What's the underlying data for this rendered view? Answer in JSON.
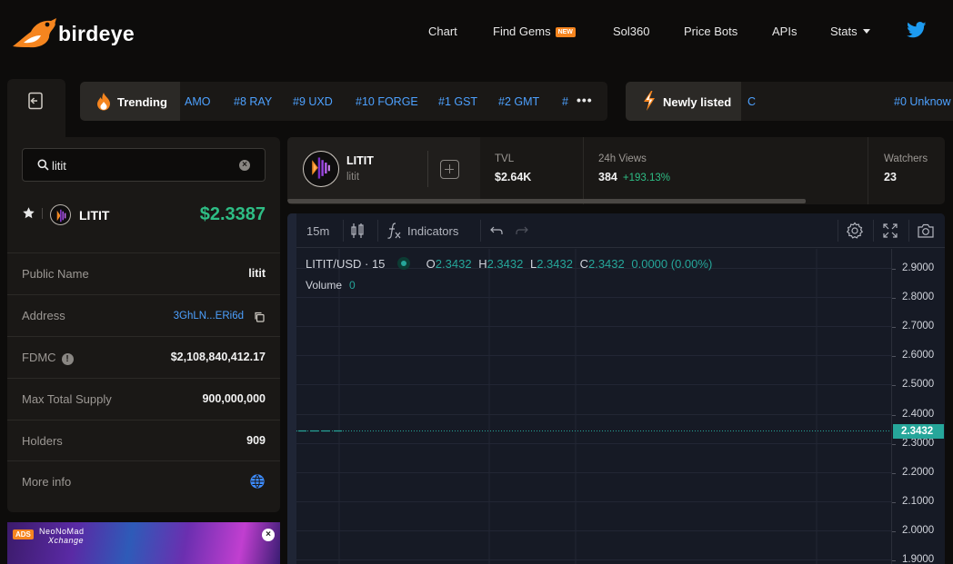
{
  "nav": {
    "brand": "birdeye",
    "items": [
      {
        "label": "Chart"
      },
      {
        "label": "Find Gems",
        "badge": "NEW"
      },
      {
        "label": "Sol360"
      },
      {
        "label": "Price Bots"
      },
      {
        "label": "APIs"
      },
      {
        "label": "Stats"
      }
    ],
    "social_icon": "twitter-icon"
  },
  "search": {
    "value": "litit"
  },
  "token": {
    "name": "LITIT",
    "symbol": "litit",
    "price": "$2.3387"
  },
  "info": {
    "public_name": {
      "label": "Public Name",
      "value": "litit"
    },
    "address": {
      "label": "Address",
      "value": "3GhLN...ERi6d"
    },
    "fdmc": {
      "label": "FDMC",
      "value": "$2,108,840,412.17"
    },
    "max_supply": {
      "label": "Max Total Supply",
      "value": "900,000,000"
    },
    "holders": {
      "label": "Holders",
      "value": "909"
    },
    "more_info": {
      "label": "More info"
    }
  },
  "ad": {
    "badge": "ADS",
    "line1": "NeoNoMad",
    "line2": "Xchange"
  },
  "trending": {
    "label": "Trending",
    "items": [
      "AMO",
      "#8 RAY",
      "#9 UXD",
      "#10 FORGE",
      "#1 GST",
      "#2 GMT",
      "#"
    ],
    "more": "•••"
  },
  "newly": {
    "label": "Newly listed",
    "items": [
      "C",
      "#0 Unknow"
    ]
  },
  "stats": {
    "tvl": {
      "label": "TVL",
      "value": "$2.64K"
    },
    "views": {
      "label": "24h Views",
      "value": "384",
      "change": "+193.13%"
    },
    "watchers": {
      "label": "Watchers",
      "value": "23"
    }
  },
  "chart": {
    "interval": "15m",
    "indicators_label": "Indicators",
    "pair": "LITIT/USD · 15",
    "ohlc": {
      "o_label": "O",
      "o": "2.3432",
      "h_label": "H",
      "h": "2.3432",
      "l_label": "L",
      "l": "2.3432",
      "c_label": "C",
      "c": "2.3432",
      "change": "0.0000 (0.00%)"
    },
    "volume_label": "Volume",
    "volume_value": "0",
    "current_price_tag": "2.3432",
    "colors": {
      "up": "#26a69a",
      "background": "#161a25",
      "grid": "#2a2e39"
    }
  },
  "chart_data": {
    "type": "line",
    "title": "LITIT/USD · 15",
    "xlabel": "",
    "ylabel": "",
    "y_ticks": [
      "2.9000",
      "2.8000",
      "2.7000",
      "2.6000",
      "2.5000",
      "2.4000",
      "2.3000",
      "2.2000",
      "2.1000",
      "2.0000",
      "1.9000"
    ],
    "ylim": [
      1.9,
      2.9
    ],
    "series": [
      {
        "values": [
          2.3432,
          2.3432,
          2.3432,
          2.3432
        ]
      }
    ],
    "current_price": 2.3432,
    "grid": true
  }
}
